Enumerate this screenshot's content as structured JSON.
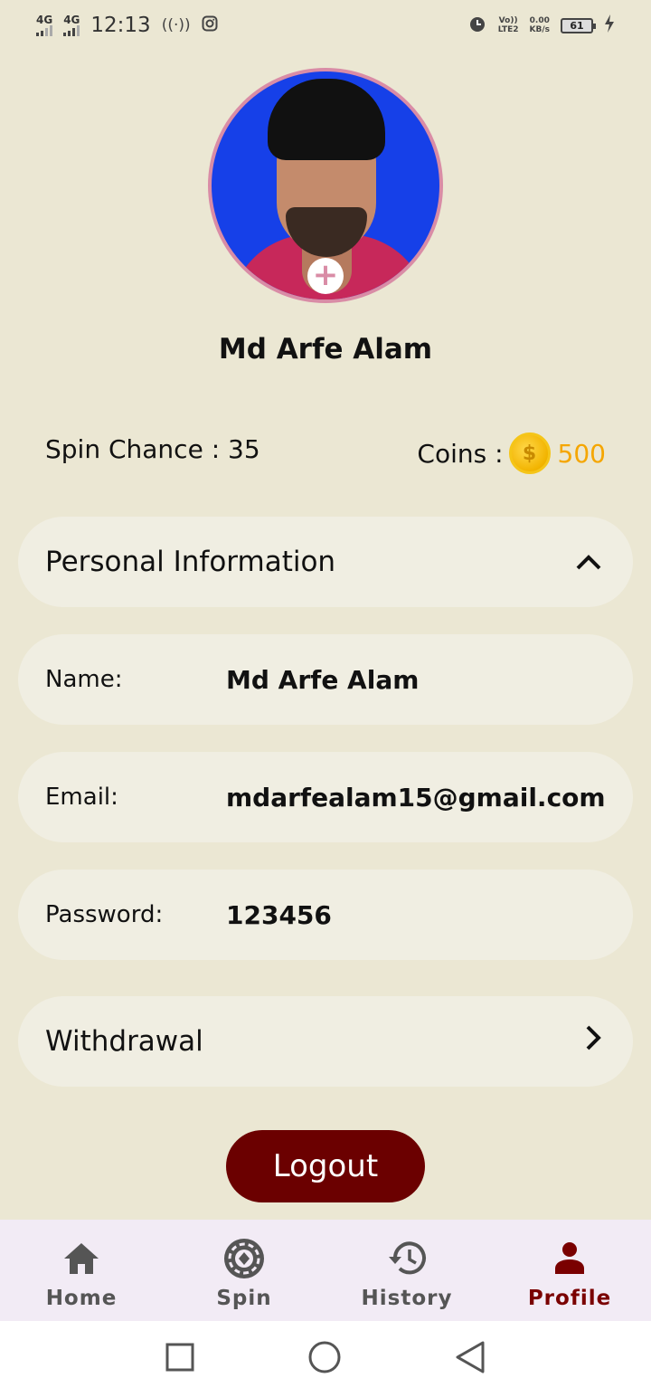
{
  "status_bar": {
    "network1": "4G",
    "network2": "4G",
    "time": "12:13",
    "volte": "Vo))",
    "lte": "LTE2",
    "speed": "0.00",
    "speed_unit": "KB/s",
    "battery": "61"
  },
  "profile": {
    "name": "Md Arfe Alam",
    "add_photo_icon": "plus-icon"
  },
  "stats": {
    "spin_label": "Spin Chance :",
    "spin_value": "35",
    "coins_label": "Coins :",
    "coins_value": "500",
    "coin_symbol": "$",
    "coin_color": "#f5a600"
  },
  "personal_info": {
    "title": "Personal Information",
    "fields": [
      {
        "label": "Name:",
        "value": "Md Arfe Alam"
      },
      {
        "label": "Email:",
        "value": "mdarfealam15@gmail.com"
      },
      {
        "label": "Password:",
        "value": "123456"
      }
    ]
  },
  "withdrawal": {
    "title": "Withdrawal"
  },
  "logout": {
    "label": "Logout",
    "color": "#6b0000"
  },
  "bottom_nav": {
    "items": [
      {
        "label": "Home",
        "icon": "home-icon"
      },
      {
        "label": "Spin",
        "icon": "spin-wheel-icon"
      },
      {
        "label": "History",
        "icon": "history-icon"
      },
      {
        "label": "Profile",
        "icon": "person-icon",
        "active": true
      }
    ],
    "active_color": "#7a0000"
  }
}
